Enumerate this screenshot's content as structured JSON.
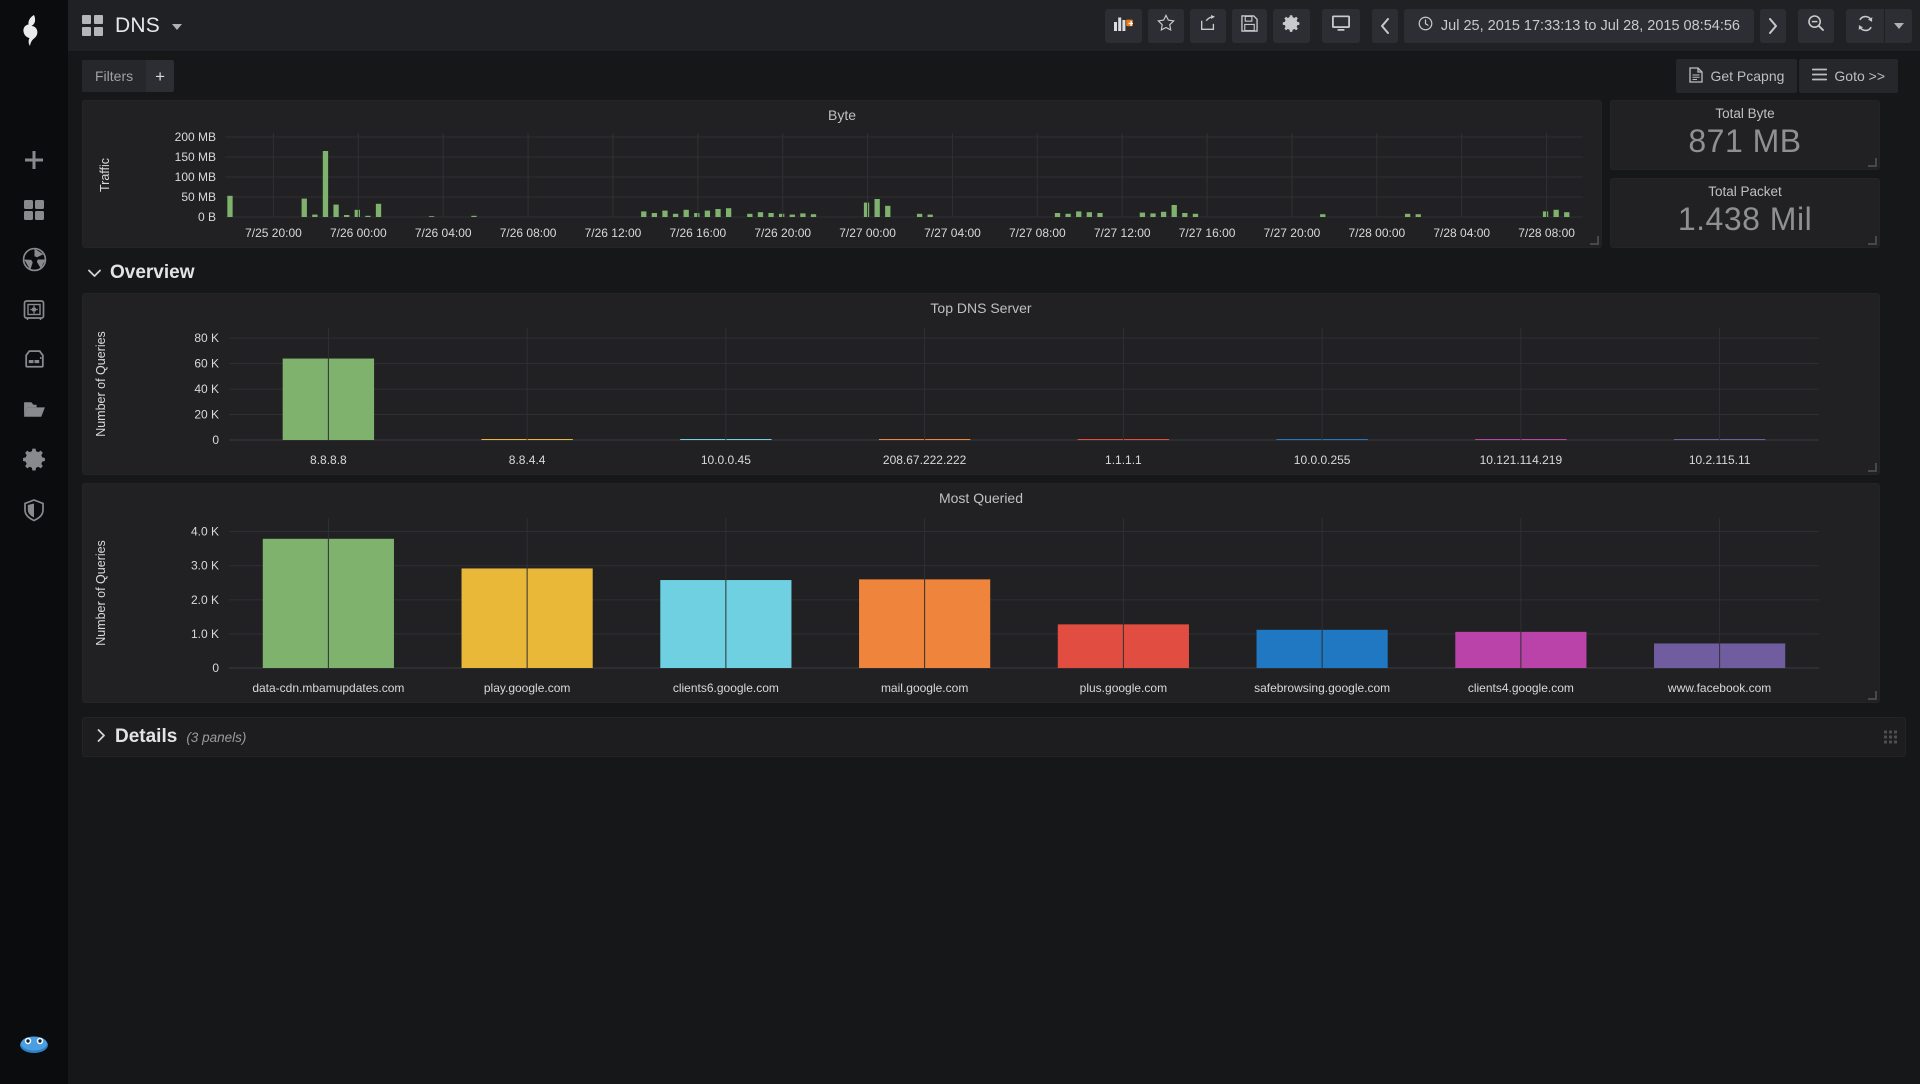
{
  "sidebar": {
    "logo_name": "grafana-logo",
    "items": [
      {
        "name": "add-panel-icon",
        "label": "Add"
      },
      {
        "name": "dashboards-icon",
        "label": "Dashboards"
      },
      {
        "name": "aperture-icon",
        "label": "Capture"
      },
      {
        "name": "safe-icon",
        "label": "Vault"
      },
      {
        "name": "server-icon",
        "label": "Servers"
      },
      {
        "name": "folder-icon",
        "label": "Files"
      },
      {
        "name": "gear-icon",
        "label": "Settings"
      },
      {
        "name": "shield-icon",
        "label": "Security"
      }
    ],
    "bottom_item": {
      "name": "wireshark-icon",
      "label": "Wireshark"
    }
  },
  "topnav": {
    "dashboard_title": "DNS",
    "buttons": [
      {
        "name": "add-panel-button",
        "icon": "bar-chart-plus-icon",
        "label": ""
      },
      {
        "name": "star-button",
        "icon": "star-icon",
        "label": ""
      },
      {
        "name": "share-button",
        "icon": "share-icon",
        "label": ""
      },
      {
        "name": "save-button",
        "icon": "floppy-disk-icon",
        "label": ""
      },
      {
        "name": "settings-button",
        "icon": "gear-icon",
        "label": ""
      },
      {
        "name": "tv-mode-button",
        "icon": "monitor-icon",
        "label": ""
      }
    ],
    "time_prev_label": "‹",
    "time_next_label": "›",
    "time_range": "Jul 25, 2015 17:33:13 to Jul 28, 2015 08:54:56",
    "zoom_out_name": "zoom-out-icon",
    "refresh_name": "refresh-icon",
    "refresh_caret_name": "refresh-dropdown-caret"
  },
  "submenu": {
    "filters_label": "Filters",
    "filters_add_label": "+",
    "get_pcapng_label": "Get Pcapng",
    "goto_label": "Goto >>"
  },
  "panels": {
    "byte": {
      "title": "Byte"
    },
    "total_byte": {
      "title": "Total Byte",
      "value": "871 MB"
    },
    "total_packet": {
      "title": "Total Packet",
      "value": "1.438 Mil"
    },
    "top_dns_server": {
      "title": "Top DNS Server"
    },
    "most_queried": {
      "title": "Most Queried"
    }
  },
  "sections": {
    "overview": {
      "title": "Overview",
      "collapsed": false,
      "chevron": "⌄"
    },
    "details": {
      "title": "Details",
      "sub": "(3 panels)",
      "collapsed": true,
      "chevron": "›"
    }
  },
  "colors": {
    "green": "#7eb26d",
    "yellow": "#eab839",
    "cyan": "#6ed0e0",
    "orange": "#ef843c",
    "red": "#e24d42",
    "blue": "#1f78c1",
    "magenta": "#ba43a9",
    "purple": "#705da0",
    "panel_bg": "#212124",
    "page_bg": "#161719",
    "grid": "#2e3033"
  },
  "chart_data": [
    {
      "id": "byte",
      "type": "bar",
      "title": "Byte",
      "xlabel": "",
      "ylabel": "Traffic",
      "ylim": [
        0,
        210000000
      ],
      "ytick_labels": [
        "0 B",
        "50 MB",
        "100 MB",
        "150 MB",
        "200 MB"
      ],
      "ytick_values": [
        0,
        50000000,
        100000000,
        150000000,
        200000000
      ],
      "xtick_labels": [
        "7/25 20:00",
        "7/26 00:00",
        "7/26 04:00",
        "7/26 08:00",
        "7/26 12:00",
        "7/26 16:00",
        "7/26 20:00",
        "7/27 00:00",
        "7/27 04:00",
        "7/27 08:00",
        "7/27 12:00",
        "7/27 16:00",
        "7/27 20:00",
        "7/28 00:00",
        "7/28 04:00",
        "7/28 08:00"
      ],
      "series": [
        {
          "name": "Traffic",
          "color": "#7eb26d",
          "values": [
            53,
            0,
            0,
            0,
            0,
            0,
            0,
            46,
            6,
            165,
            31,
            5,
            18,
            3,
            33,
            0,
            0,
            0,
            0,
            2,
            0,
            0,
            0,
            3,
            0,
            0,
            0,
            0,
            0,
            0,
            0,
            0,
            0,
            0,
            0,
            0,
            0,
            0,
            0,
            14,
            10,
            16,
            8,
            18,
            10,
            16,
            20,
            22,
            0,
            8,
            12,
            10,
            8,
            6,
            9,
            7,
            0,
            0,
            0,
            0,
            36,
            45,
            28,
            0,
            0,
            8,
            6,
            0,
            0,
            0,
            0,
            0,
            0,
            0,
            0,
            0,
            0,
            0,
            10,
            8,
            14,
            12,
            10,
            0,
            0,
            0,
            11,
            9,
            13,
            30,
            10,
            8,
            0,
            0,
            0,
            0,
            0,
            0,
            0,
            0,
            0,
            0,
            0,
            7,
            0,
            0,
            0,
            0,
            0,
            0,
            0,
            8,
            7,
            0,
            0,
            0,
            0,
            0,
            0,
            0,
            0,
            0,
            0,
            0,
            14,
            18,
            12,
            0
          ]
        }
      ],
      "units": "MB",
      "grid": true,
      "legend": "none"
    },
    {
      "id": "top_dns_server",
      "type": "bar",
      "title": "Top DNS Server",
      "xlabel": "",
      "ylabel": "Number of Queries",
      "ylim": [
        0,
        88000
      ],
      "ytick_labels": [
        "0",
        "20 K",
        "40 K",
        "60 K",
        "80 K"
      ],
      "ytick_values": [
        0,
        20000,
        40000,
        60000,
        80000
      ],
      "categories": [
        "8.8.8.8",
        "8.8.4.4",
        "10.0.0.45",
        "208.67.222.222",
        "1.1.1.1",
        "10.0.0.255",
        "10.121.114.219",
        "10.2.115.11"
      ],
      "values": [
        64000,
        600,
        120,
        90,
        70,
        55,
        40,
        30
      ],
      "bar_colors": [
        "#7eb26d",
        "#eab839",
        "#6ed0e0",
        "#ef843c",
        "#e24d42",
        "#1f78c1",
        "#ba43a9",
        "#705da0"
      ],
      "grid": true,
      "legend": "none"
    },
    {
      "id": "most_queried",
      "type": "bar",
      "title": "Most Queried",
      "xlabel": "",
      "ylabel": "Number of Queries",
      "ylim": [
        0,
        4400
      ],
      "ytick_labels": [
        "0",
        "1.0 K",
        "2.0 K",
        "3.0 K",
        "4.0 K"
      ],
      "ytick_values": [
        0,
        1000,
        2000,
        3000,
        4000
      ],
      "categories": [
        "data-cdn.mbamupdates.com",
        "play.google.com",
        "clients6.google.com",
        "mail.google.com",
        "plus.google.com",
        "safebrowsing.google.com",
        "clients4.google.com",
        "www.facebook.com"
      ],
      "values": [
        3790,
        2920,
        2580,
        2600,
        1280,
        1120,
        1060,
        720
      ],
      "bar_colors": [
        "#7eb26d",
        "#eab839",
        "#6ed0e0",
        "#ef843c",
        "#e24d42",
        "#1f78c1",
        "#ba43a9",
        "#705da0"
      ],
      "grid": true,
      "legend": "none"
    }
  ]
}
